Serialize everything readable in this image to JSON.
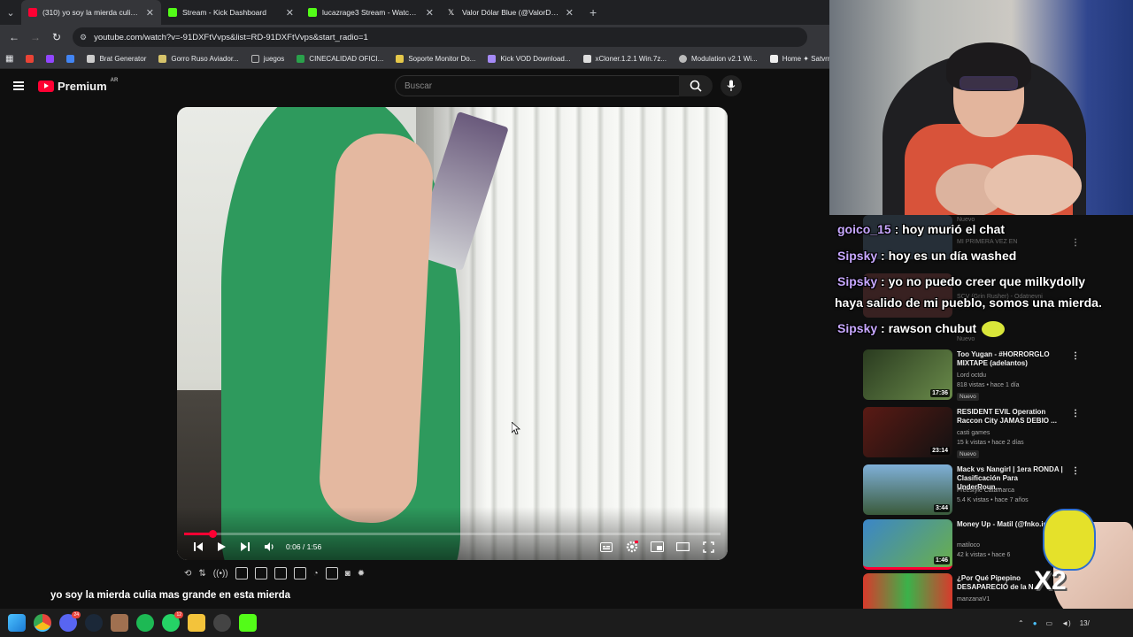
{
  "browser": {
    "tabs": [
      {
        "title": "(310) yo soy la mierda culia mas",
        "color": "#ff0033",
        "active": true
      },
      {
        "title": "Stream - Kick Dashboard",
        "color": "#53fc18",
        "active": false
      },
      {
        "title": "lucazrage3 Stream - Watch Live",
        "color": "#53fc18",
        "active": false
      },
      {
        "title": "Valor Dólar Blue (@ValorDolarB",
        "color": "#ffffff",
        "active": false
      }
    ],
    "url": "youtube.com/watch?v=-91DXFtVvps&list=RD-91DXFtVvps&start_radio=1",
    "bookmarks": [
      {
        "label": "",
        "color": "#ea4335"
      },
      {
        "label": "",
        "color": "#9146ff"
      },
      {
        "label": "",
        "color": "#4285f4"
      },
      {
        "label": "Brat Generator",
        "color": "#cccccc"
      },
      {
        "label": "Gorro Ruso Aviador...",
        "color": "#d6c36b"
      },
      {
        "label": "juegos",
        "color": "#888888"
      },
      {
        "label": "CINECALIDAD OFICI...",
        "color": "#2aa14b"
      },
      {
        "label": "Soporte Monitor Do...",
        "color": "#e5c84a"
      },
      {
        "label": "Kick VOD Download...",
        "color": "#a58af7"
      },
      {
        "label": "xCloner.1.2.1 Win.7z...",
        "color": "#dddddd"
      },
      {
        "label": "Modulation v2.1 Wi...",
        "color": "#bbbbbb"
      },
      {
        "label": "Home ✦ Satvrn",
        "color": "#eeeeee"
      }
    ]
  },
  "youtube": {
    "logo_text": "Premium",
    "logo_region": "AR",
    "search_placeholder": "Buscar",
    "player": {
      "time": "0:06 / 1:56",
      "progress_fraction": 0.052
    },
    "video_title": "yo soy la mierda culia mas grande en esta mierda"
  },
  "chat": [
    {
      "user": "goico_15",
      "message": "hoy murió el chat"
    },
    {
      "user": "Sipsky",
      "message": "hoy es un día washed"
    },
    {
      "user": "Sipsky",
      "message": "yo no puedo creer que milkydolly"
    },
    {
      "user": "",
      "message": "haya salido de mi pueblo, somos una mierda."
    },
    {
      "user": "Sipsky",
      "message": "rawson chubut"
    }
  ],
  "chat_separator": " : ",
  "recommendations": [
    {
      "title": "Too Yugan - #HORRORGLO MIXTAPE (adelantos)",
      "channel": "Lord octdu",
      "meta": "818 vistas • hace 1 día",
      "duration": "17:36",
      "badge": "Nuevo",
      "thumb": "#3c5b2e"
    },
    {
      "title": "RESIDENT EVIL Operation Raccon City JAMAS DEBIO ...",
      "channel": "casti games",
      "meta": "15 k vistas • hace 2 días",
      "duration": "23:14",
      "badge": "Nuevo",
      "thumb": "#6a2a20"
    },
    {
      "title": "Mack vs Nangirl | 1era RONDA | Clasificación Para UnderRoun...",
      "channel": "Freestyle Catamarca",
      "meta": "5.4 K vistas • hace 7 años",
      "duration": "3:44",
      "badge": "",
      "thumb": "#5b8fb3"
    },
    {
      "title": "Money Up - Matil (@fnko.inc)",
      "channel": "matiloco",
      "meta": "42 k vistas • hace 6",
      "duration": "1:46",
      "badge": "",
      "thumb": "#3b86c8"
    },
    {
      "title": "¿Por Qué Pipepino DESAPARECIÓ de la N",
      "channel": "manzanaV1",
      "meta": "",
      "duration": "",
      "badge": "",
      "thumb": "#d83a2c"
    }
  ],
  "sidebar_top_partial": [
    "Nuevo",
    "MI PRIMERA VEZ EN",
    "SCV (Grin Rusher) - Odatnevni",
    "Nuevo"
  ],
  "sticker_text": "X2",
  "taskbar": {
    "icons": [
      {
        "name": "windows-start-icon",
        "color": "#4cc2ff"
      },
      {
        "name": "chrome-icon",
        "color": "#e8453c"
      },
      {
        "name": "discord-icon",
        "color": "#5865f2",
        "badge": "24"
      },
      {
        "name": "steam-icon",
        "color": "#1b2838"
      },
      {
        "name": "app-icon",
        "color": "#a07050"
      },
      {
        "name": "spotify-icon",
        "color": "#1db954"
      },
      {
        "name": "whatsapp-icon",
        "color": "#25d366",
        "badge": "12"
      },
      {
        "name": "file-explorer-icon",
        "color": "#f3c33b"
      },
      {
        "name": "obs-icon",
        "color": "#444444"
      },
      {
        "name": "kick-icon",
        "color": "#53fc18"
      }
    ],
    "clock": "13/"
  }
}
